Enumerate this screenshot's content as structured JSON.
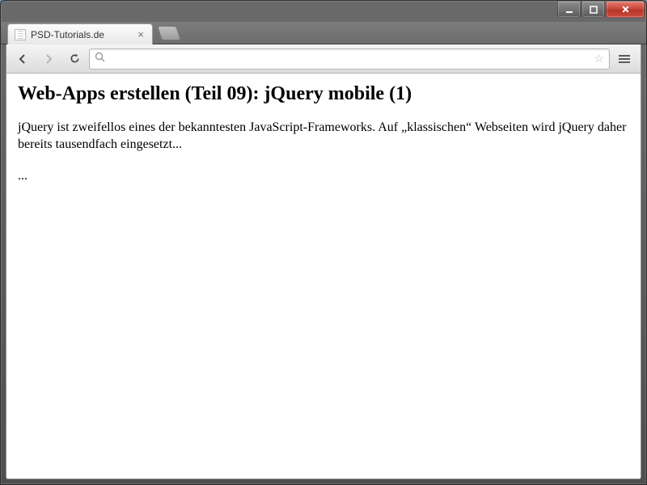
{
  "window": {
    "title": "PSD-Tutorials.de"
  },
  "tabs": [
    {
      "label": "PSD-Tutorials.de"
    }
  ],
  "omnibox": {
    "value": "",
    "placeholder": ""
  },
  "page": {
    "heading": "Web-Apps erstellen (Teil 09): jQuery mobile (1)",
    "paragraph": "jQuery ist zweifellos eines der bekanntesten JavaScript-Frameworks. Auf „klassischen“ Webseiten wird jQuery daher bereits tausendfach eingesetzt...",
    "ellipsis": "..."
  }
}
